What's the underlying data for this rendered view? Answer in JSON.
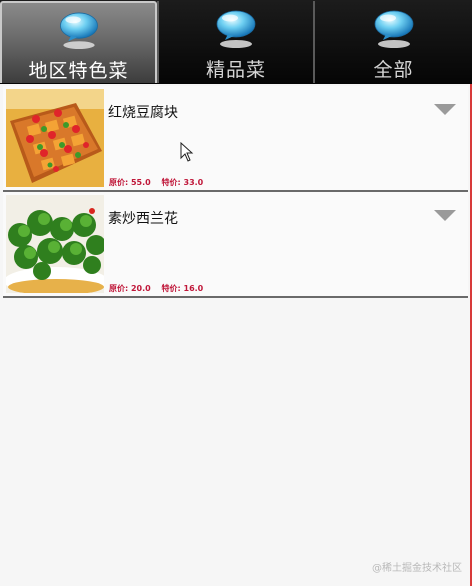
{
  "tabs": [
    {
      "label": "地区特色菜",
      "active": true
    },
    {
      "label": "精品菜",
      "active": false
    },
    {
      "label": "全部",
      "active": false
    }
  ],
  "dishes": [
    {
      "name": "红烧豆腐块",
      "original_price": "原价: 55.0",
      "special_price": "特价: 33.0",
      "icon": "tofu-dish-image"
    },
    {
      "name": "素炒西兰花",
      "original_price": "原价: 20.0",
      "special_price": "特价: 16.0",
      "icon": "broccoli-dish-image"
    }
  ],
  "watermark": "@稀土掘金技术社区",
  "colors": {
    "price": "#c0183a",
    "tabbar": "#0d0d0d",
    "active_tab": "#6a6a6a"
  }
}
